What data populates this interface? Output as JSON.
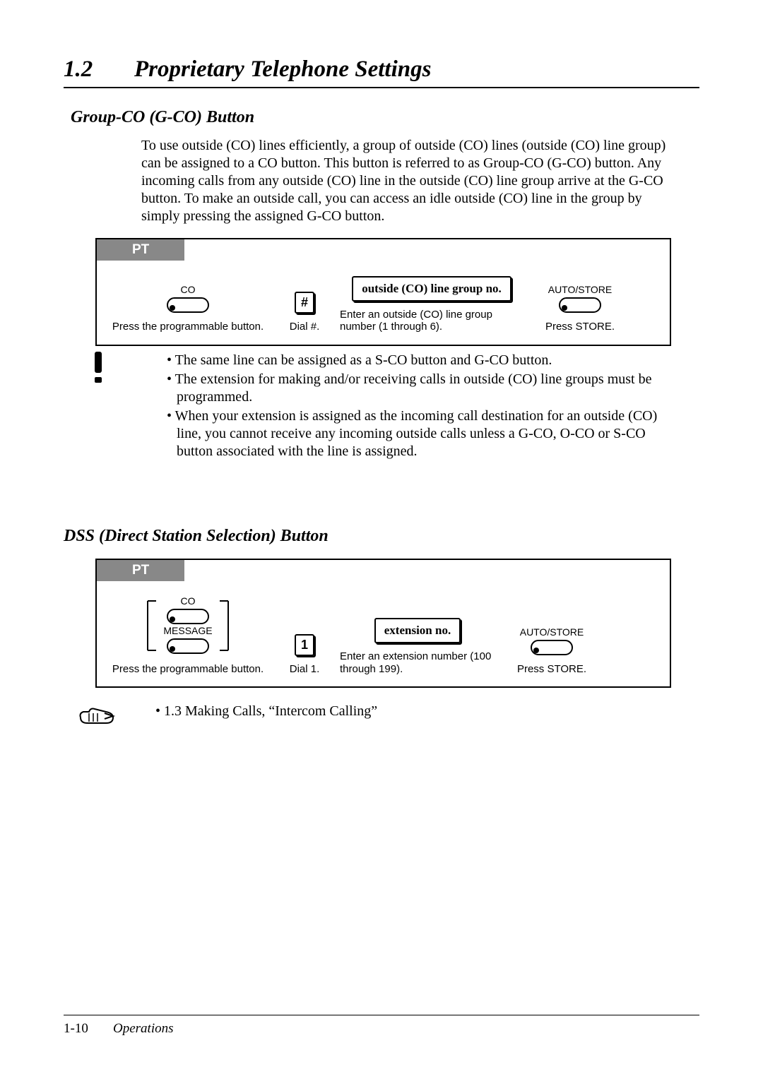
{
  "chapter": {
    "number": "1.2",
    "title": "Proprietary Telephone Settings"
  },
  "gco": {
    "heading": "Group-CO (G-CO) Button",
    "intro": "To use outside (CO) lines efficiently, a group of outside (CO) lines (outside (CO) line group) can be assigned to a CO button. This button is referred to as Group-CO (G-CO) button. Any incoming calls from any outside (CO) line in the outside (CO) line group arrive at the G-CO button. To make an outside call, you can access an idle outside (CO) line in the group by simply pressing the assigned G-CO button.",
    "panel": {
      "tag": "PT",
      "col1": {
        "top": "CO",
        "caption": "Press the programmable button."
      },
      "col2": {
        "key": "#",
        "caption": "Dial #."
      },
      "col3": {
        "field": "outside (CO) line group no.",
        "caption": "Enter an outside (CO) line group number (1 through 6)."
      },
      "col4": {
        "top": "AUTO/STORE",
        "caption": "Press STORE."
      }
    },
    "notes": [
      "The same line can be assigned as a S-CO button and G-CO button.",
      "The extension for making and/or receiving calls in outside (CO) line groups must be programmed.",
      "When your extension is assigned as the incoming call destination for an outside (CO) line, you cannot receive any incoming outside calls unless a G-CO, O-CO or S-CO button associated with the line is assigned."
    ]
  },
  "dss": {
    "heading": "DSS (Direct Station Selection) Button",
    "panel": {
      "tag": "PT",
      "col1": {
        "top": "CO",
        "mid": "MESSAGE",
        "caption": "Press the programmable button."
      },
      "col2": {
        "key": "1",
        "caption": "Dial 1."
      },
      "col3": {
        "field": "extension no.",
        "caption": "Enter an extension number (100 through 199)."
      },
      "col4": {
        "top": "AUTO/STORE",
        "caption": "Press STORE."
      }
    },
    "ref": "1.3 Making Calls, “Intercom Calling”"
  },
  "footer": {
    "page": "1-10",
    "section": "Operations"
  }
}
